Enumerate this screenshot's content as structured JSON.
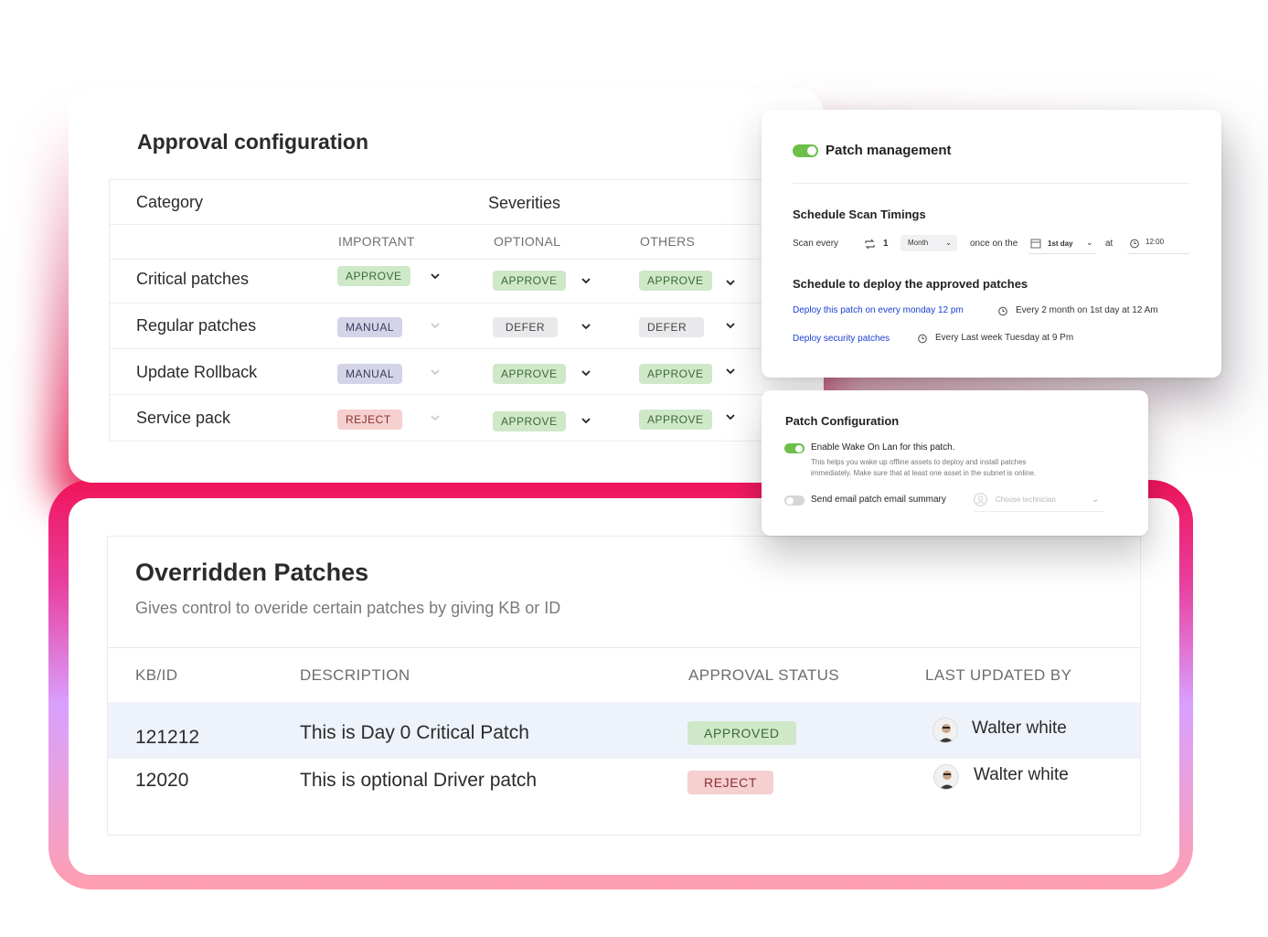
{
  "approval": {
    "title": "Approval configuration",
    "header_category": "Category",
    "header_severities": "Severities",
    "columns": [
      "IMPORTANT",
      "OPTIONAL",
      "OTHERS"
    ],
    "rows": [
      {
        "label": "Critical patches",
        "important": "APPROVE",
        "optional": "APPROVE",
        "others": "APPROVE"
      },
      {
        "label": "Regular patches",
        "important": "MANUAL",
        "optional": "DEFER",
        "others": "DEFER"
      },
      {
        "label": "Update Rollback",
        "important": "MANUAL",
        "optional": "APPROVE",
        "others": "APPROVE"
      },
      {
        "label": "Service pack",
        "important": "REJECT",
        "optional": "APPROVE",
        "others": "APPROVE"
      }
    ]
  },
  "overridden": {
    "title": "Overridden Patches",
    "subtitle": "Gives control to overide certain patches by giving KB or ID",
    "columns": [
      "KB/ID",
      "DESCRIPTION",
      "APPROVAL STATUS",
      "LAST UPDATED BY"
    ],
    "rows": [
      {
        "id": "121212",
        "description": "This is Day 0 Critical Patch",
        "status": "APPROVED",
        "user": "Walter white"
      },
      {
        "id": "12020",
        "description": "This is optional Driver patch",
        "status": "REJECT",
        "user": "Walter white"
      }
    ]
  },
  "patch_management": {
    "title": "Patch management",
    "scan_heading": "Schedule Scan Timings",
    "scan_every": "Scan every",
    "scan_count": "1",
    "scan_unit": "Month",
    "once_on_the": "once on the",
    "day": "1st day",
    "at": "at",
    "time": "12:00",
    "deploy_heading": "Schedule to deploy the approved patches",
    "deploy_items": [
      {
        "link": "Deploy this patch on every monday 12 pm",
        "schedule": "Every 2 month on 1st day at 12 Am"
      },
      {
        "link": "Deploy security patches",
        "schedule": "Every Last week Tuesday at 9 Pm"
      }
    ]
  },
  "patch_config": {
    "title": "Patch Configuration",
    "wake_on_lan_label": "Enable Wake On Lan for this patch.",
    "wake_on_lan_note_1": "This helps you wake up offline assets to deploy and install patches",
    "wake_on_lan_note_2": "immediately. Make sure that at least one asset in the subnet is online.",
    "email_summary_label": "Send email patch email summary",
    "technician_placeholder": "Choose technician"
  },
  "colors": {
    "approve": "#cfe8c8",
    "defer": "#e9e9ec",
    "manual": "#d3d4e8",
    "reject": "#f6cfcf",
    "toggle_on": "#6cbf4a",
    "link": "#1a3fd1"
  }
}
